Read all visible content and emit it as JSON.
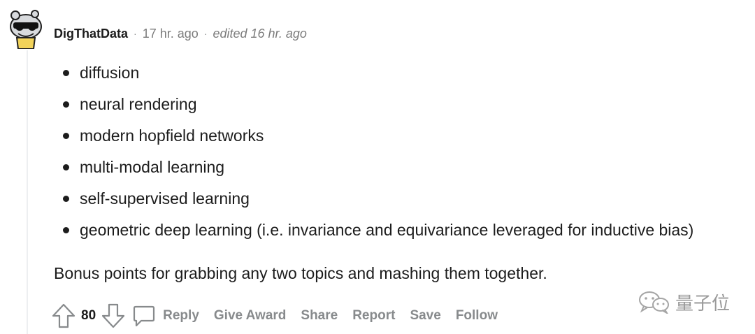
{
  "comment": {
    "author": "DigThatData",
    "separator": "·",
    "time": "17 hr. ago",
    "edited": "edited 16 hr. ago",
    "topics": [
      "diffusion",
      "neural rendering",
      "modern hopfield networks",
      "multi-modal learning",
      "self-supervised learning",
      "geometric deep learning (i.e. invariance and equivariance leveraged for inductive bias)"
    ],
    "bonus_text": "Bonus points for grabbing any two topics and mashing them together."
  },
  "actions": {
    "score": "80",
    "reply": "Reply",
    "give_award": "Give Award",
    "share": "Share",
    "report": "Report",
    "save": "Save",
    "follow": "Follow",
    "icons": [
      "upvote-icon",
      "downvote-icon",
      "comment-bubble-icon"
    ]
  },
  "watermark": {
    "text": "量子位",
    "icon": "wechat-icon"
  },
  "colors": {
    "text": "#1c1c1c",
    "meta": "#7c7c7c",
    "action": "#878a8c",
    "thread_line": "#edeff1"
  }
}
